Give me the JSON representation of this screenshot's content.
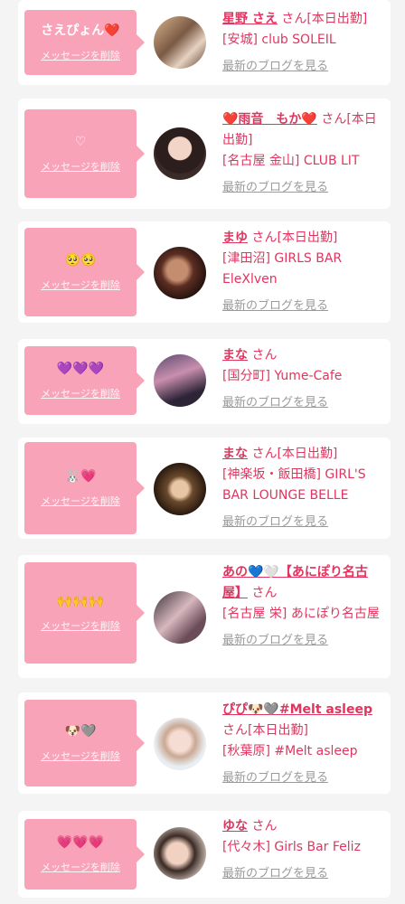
{
  "delete_label": "メッセージを削除",
  "blog_label": "最新のブログを見る",
  "colors": {
    "accent": "#e0355f",
    "bubble": "#f9a3b8",
    "card": "#ffffff",
    "bg": "#f4f4f4",
    "link_gray": "#9a9a9a"
  },
  "cards": [
    {
      "message": "さえぴょん❤️",
      "name": "星野 さえ",
      "suffix": "さん[本日出勤]",
      "shop": "[安城] club SOLEIL",
      "avatar_icon": "avatar-photo"
    },
    {
      "message": "♡",
      "name": "❤️雨音　もか❤️",
      "suffix": "さん[本日出勤]",
      "shop": "[名古屋 金山] CLUB LIT",
      "avatar_icon": "avatar-photo"
    },
    {
      "message": "🥺🥺",
      "name": "まゆ",
      "suffix": "さん[本日出勤]",
      "shop": "[津田沼] GIRLS BAR EleXlven",
      "avatar_icon": "avatar-photo"
    },
    {
      "message": "💜💜💜",
      "name": "まな",
      "suffix": "さん",
      "shop": "[国分町] Yume-Cafe",
      "avatar_icon": "avatar-photo"
    },
    {
      "message": "🐰💗",
      "name": "まな",
      "suffix": "さん[本日出勤]",
      "shop": "[神楽坂・飯田橋] GIRL'S BAR LOUNGE BELLE",
      "avatar_icon": "avatar-photo"
    },
    {
      "message": "🙌🙌🙌",
      "name": "あの💙🤍【あにぽり名古屋】",
      "suffix": "さん",
      "shop": "[名古屋 栄] あにぽり名古屋",
      "avatar_icon": "avatar-photo"
    },
    {
      "message": "🐶🩶",
      "name": "ぴぴ🐶🩶#Melt asleep",
      "suffix": "さん[本日出勤]",
      "shop": "[秋葉原] #Melt asleep",
      "avatar_icon": "avatar-photo"
    },
    {
      "message": "💗💗💗",
      "name": "ゆな",
      "suffix": "さん",
      "shop": "[代々木] Girls Bar Feliz",
      "avatar_icon": "avatar-photo"
    }
  ]
}
